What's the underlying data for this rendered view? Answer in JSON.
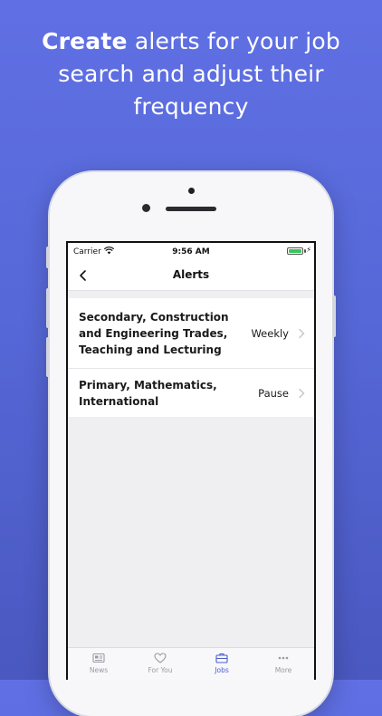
{
  "headline": {
    "bold": "Create",
    "rest": " alerts for your job search and adjust their frequency"
  },
  "status": {
    "carrier": "Carrier",
    "time": "9:56 AM"
  },
  "nav": {
    "title": "Alerts"
  },
  "alerts": [
    {
      "title": "Secondary, Construction and Engineering Trades, Teaching and Lecturing",
      "frequency": "Weekly"
    },
    {
      "title": "Primary, Mathematics, International",
      "frequency": "Pause"
    }
  ],
  "tabs": [
    {
      "label": "News",
      "icon": "newspaper-icon",
      "active": false
    },
    {
      "label": "For You",
      "icon": "heart-icon",
      "active": false
    },
    {
      "label": "Jobs",
      "icon": "briefcase-icon",
      "active": true
    },
    {
      "label": "More",
      "icon": "more-dots-icon",
      "active": false
    }
  ],
  "colors": {
    "background": "#5a6ae0",
    "accent": "#4a5bd0",
    "battery": "#35c759"
  }
}
